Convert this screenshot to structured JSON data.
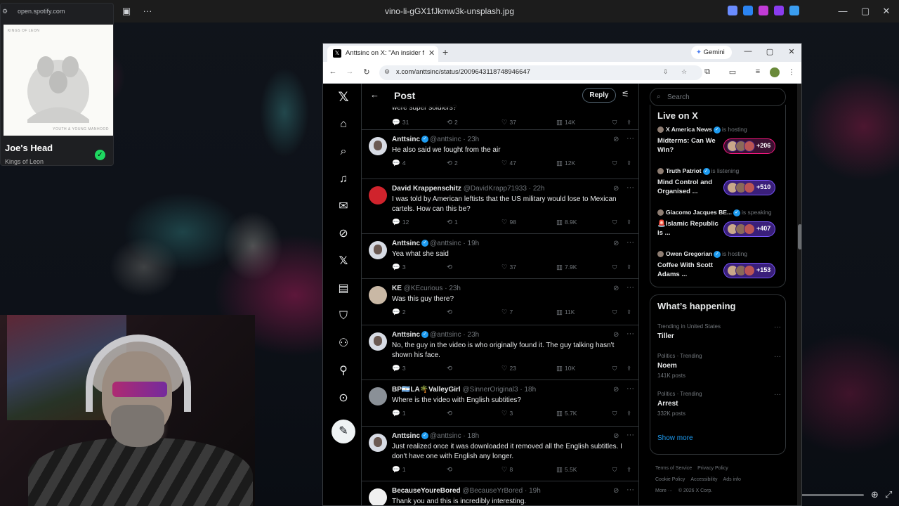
{
  "viewer": {
    "filename": "vino-li-gGX1fJkmw3k-unsplash.jpg"
  },
  "spotify": {
    "url": "open.spotify.com",
    "album_band_text": "KINGS OF LEON",
    "album_sub_text": "YOUTH & YOUNG MANHOOD",
    "track": "Joe's Head",
    "artist": "Kings of Leon"
  },
  "browser": {
    "tab_title": "Anttsinc on X: \"An insider from",
    "gemini_label": "Gemini",
    "url": "x.com/anttsinc/status/2009643118748946647"
  },
  "x": {
    "header_title": "Post",
    "reply_label": "Reply",
    "search_placeholder": "Search",
    "partial_text": "were super soldiers?",
    "partial_actions": {
      "replies": "31",
      "reposts": "2",
      "likes": "37",
      "views": "14K"
    },
    "replies": [
      {
        "name": "Anttsinc",
        "verified": true,
        "handle": "@anttsinc",
        "time": "23h",
        "text": "He also said we fought from the air",
        "replies": "4",
        "reposts": "2",
        "likes": "47",
        "views": "12K",
        "avatar": "ant"
      },
      {
        "name": "David Krappenschitz",
        "verified": false,
        "handle": "@DavidKrapp71933",
        "time": "22h",
        "text": "I was told by American leftists that the US military would lose to Mexican cartels.  How can this be?",
        "replies": "12",
        "reposts": "1",
        "likes": "98",
        "views": "8.9K",
        "avatar": "red"
      },
      {
        "name": "Anttsinc",
        "verified": true,
        "handle": "@anttsinc",
        "time": "19h",
        "text": "Yea what she said",
        "replies": "3",
        "reposts": "",
        "likes": "37",
        "views": "7.9K",
        "avatar": "ant"
      },
      {
        "name": "KE",
        "verified": false,
        "handle": "@KEcurious",
        "time": "23h",
        "text": "Was this guy there?",
        "replies": "2",
        "reposts": "",
        "likes": "7",
        "views": "11K",
        "avatar": "ke"
      },
      {
        "name": "Anttsinc",
        "verified": true,
        "handle": "@anttsinc",
        "time": "23h",
        "text": "No, the guy in the video is who originally found it. The guy talking hasn't shown his face.",
        "replies": "3",
        "reposts": "",
        "likes": "23",
        "views": "10K",
        "avatar": "ant"
      },
      {
        "name": "BP🇦🇷LA🌴ValleyGirl",
        "verified": false,
        "handle": "@SinnerOriginal3",
        "time": "18h",
        "text": "Where is the video with English subtities?",
        "replies": "1",
        "reposts": "",
        "likes": "3",
        "views": "5.7K",
        "avatar": "bp"
      },
      {
        "name": "Anttsinc",
        "verified": true,
        "handle": "@anttsinc",
        "time": "18h",
        "text": "Just realized once it was downloaded it removed all the English subtitles. I don't have one with English any longer.",
        "replies": "1",
        "reposts": "",
        "likes": "8",
        "views": "5.5K",
        "avatar": "ant"
      },
      {
        "name": "BecauseYoureBored",
        "verified": false,
        "handle": "@BecauseYrBored",
        "time": "19h",
        "text": "Thank you and this is incredibly interesting.",
        "replies": "",
        "reposts": "",
        "likes": "",
        "views": "",
        "avatar": "byb"
      }
    ],
    "live": {
      "title": "Live on X",
      "items": [
        {
          "host": "X America News",
          "status": "is hosting",
          "topic": "Midterms: Can We Win?",
          "count": "+206",
          "pill": "red"
        },
        {
          "host": "Truth Patriot",
          "status": "is listening",
          "topic": "Mind Control and Organised ...",
          "count": "+510",
          "pill": "purple"
        },
        {
          "host": "Giacomo Jacques BE...",
          "status": "is speaking",
          "topic": "🚨Islamic Republic is ...",
          "count": "+407",
          "pill": "purple"
        },
        {
          "host": "Owen Gregorian",
          "status": "is hosting",
          "topic": "Coffee With Scott Adams ...",
          "count": "+153",
          "pill": "purple"
        }
      ]
    },
    "happening": {
      "title": "What’s happening",
      "trends": [
        {
          "category": "Trending in United States",
          "name": "Tiller",
          "count": ""
        },
        {
          "category": "Politics · Trending",
          "name": "Noem",
          "count": "141K posts"
        },
        {
          "category": "Politics · Trending",
          "name": "Arrest",
          "count": "332K posts"
        }
      ],
      "show_more": "Show more"
    },
    "footer": {
      "terms": "Terms of Service",
      "privacy": "Privacy Policy",
      "cookie": "Cookie Policy",
      "accessibility": "Accessibility",
      "ads": "Ads info",
      "more": "More ···",
      "copyright": "© 2026 X Corp."
    }
  }
}
